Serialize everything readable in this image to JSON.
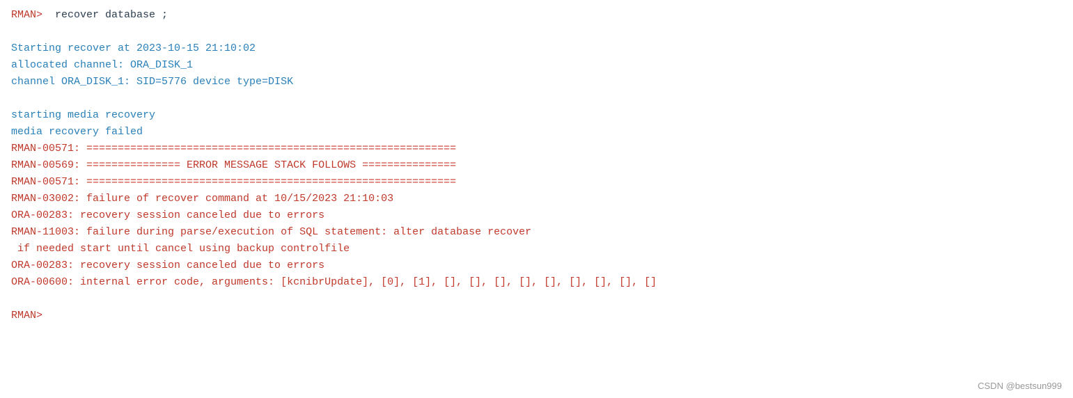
{
  "terminal": {
    "lines": [
      {
        "id": "cmd-line",
        "parts": [
          {
            "text": "RMAN> ",
            "color": "prompt"
          },
          {
            "text": " recover database ;",
            "color": "command"
          }
        ]
      },
      {
        "id": "blank1",
        "blank": true
      },
      {
        "id": "start-recover",
        "text": "Starting recover at 2023-10-15 21:10:02",
        "color": "info"
      },
      {
        "id": "alloc-channel",
        "text": "allocated channel: ORA_DISK_1",
        "color": "info"
      },
      {
        "id": "channel-info",
        "text": "channel ORA_DISK_1: SID=5776 device type=DISK",
        "color": "info"
      },
      {
        "id": "blank2",
        "blank": true
      },
      {
        "id": "starting-media",
        "text": "starting media recovery",
        "color": "info"
      },
      {
        "id": "media-failed",
        "text": "media recovery failed",
        "color": "info"
      },
      {
        "id": "rman-00571-1",
        "text": "RMAN-00571: ===========================================================",
        "color": "error"
      },
      {
        "id": "rman-00569",
        "text": "RMAN-00569: =============== ERROR MESSAGE STACK FOLLOWS ===============",
        "color": "error"
      },
      {
        "id": "rman-00571-2",
        "text": "RMAN-00571: ===========================================================",
        "color": "error"
      },
      {
        "id": "rman-03002",
        "text": "RMAN-03002: failure of recover command at 10/15/2023 21:10:03",
        "color": "error"
      },
      {
        "id": "ora-00283-1",
        "text": "ORA-00283: recovery session canceled due to errors",
        "color": "error"
      },
      {
        "id": "rman-11003",
        "text": "RMAN-11003: failure during parse/execution of SQL statement: alter database recover",
        "color": "error"
      },
      {
        "id": "rman-11003-cont",
        "text": " if needed start until cancel using backup controlfile",
        "color": "error"
      },
      {
        "id": "ora-00283-2",
        "text": "ORA-00283: recovery session canceled due to errors",
        "color": "error"
      },
      {
        "id": "ora-00600",
        "text": "ORA-00600: internal error code, arguments: [kcnibrUpdate], [0], [1], [], [], [], [], [], [], [], [], []",
        "color": "error"
      },
      {
        "id": "blank3",
        "blank": true
      },
      {
        "id": "rman-prompt",
        "text": "RMAN>",
        "color": "prompt"
      }
    ],
    "watermark": "CSDN @bestsun999"
  }
}
